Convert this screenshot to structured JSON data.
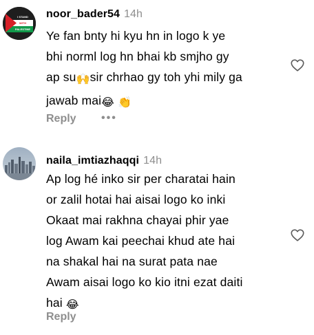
{
  "comments": [
    {
      "username": "noor_bader54",
      "time": "14h",
      "avatar_text": [
        "I STAND",
        "WITH",
        "PALESTINE"
      ],
      "lines": [
        "Ye fan bnty hi kyu hn in logo k ye",
        "bhi norml log hn bhai kb smjho gy",
        [
          "ap su",
          "🙌",
          "sir chrhao gy toh yhi mily ga"
        ],
        [
          "jawab mai",
          "😂",
          " ",
          "👏"
        ]
      ],
      "reply_label": "Reply",
      "more_label": "•••"
    },
    {
      "username": "naila_imtiazhaqqi",
      "time": "14h",
      "lines": [
        "Ap log hé inko sir per charatai hain",
        "or zalil hotai hai aisai logo ko inki",
        "Okaat mai rakhna chayai phir yae",
        "log Awam kai peechai khud ate hai",
        "na shakal hai na surat pata nae",
        "Awam aisai logo ko kio itni ezat daiti",
        [
          "hai ",
          "😂"
        ]
      ],
      "reply_label": "Reply"
    }
  ],
  "icons": {
    "like": "heart-outline-icon",
    "more": "more-options-icon"
  },
  "colors": {
    "secondary_text": "#8e8e8e",
    "heart_stroke": "#5c5c5c"
  }
}
